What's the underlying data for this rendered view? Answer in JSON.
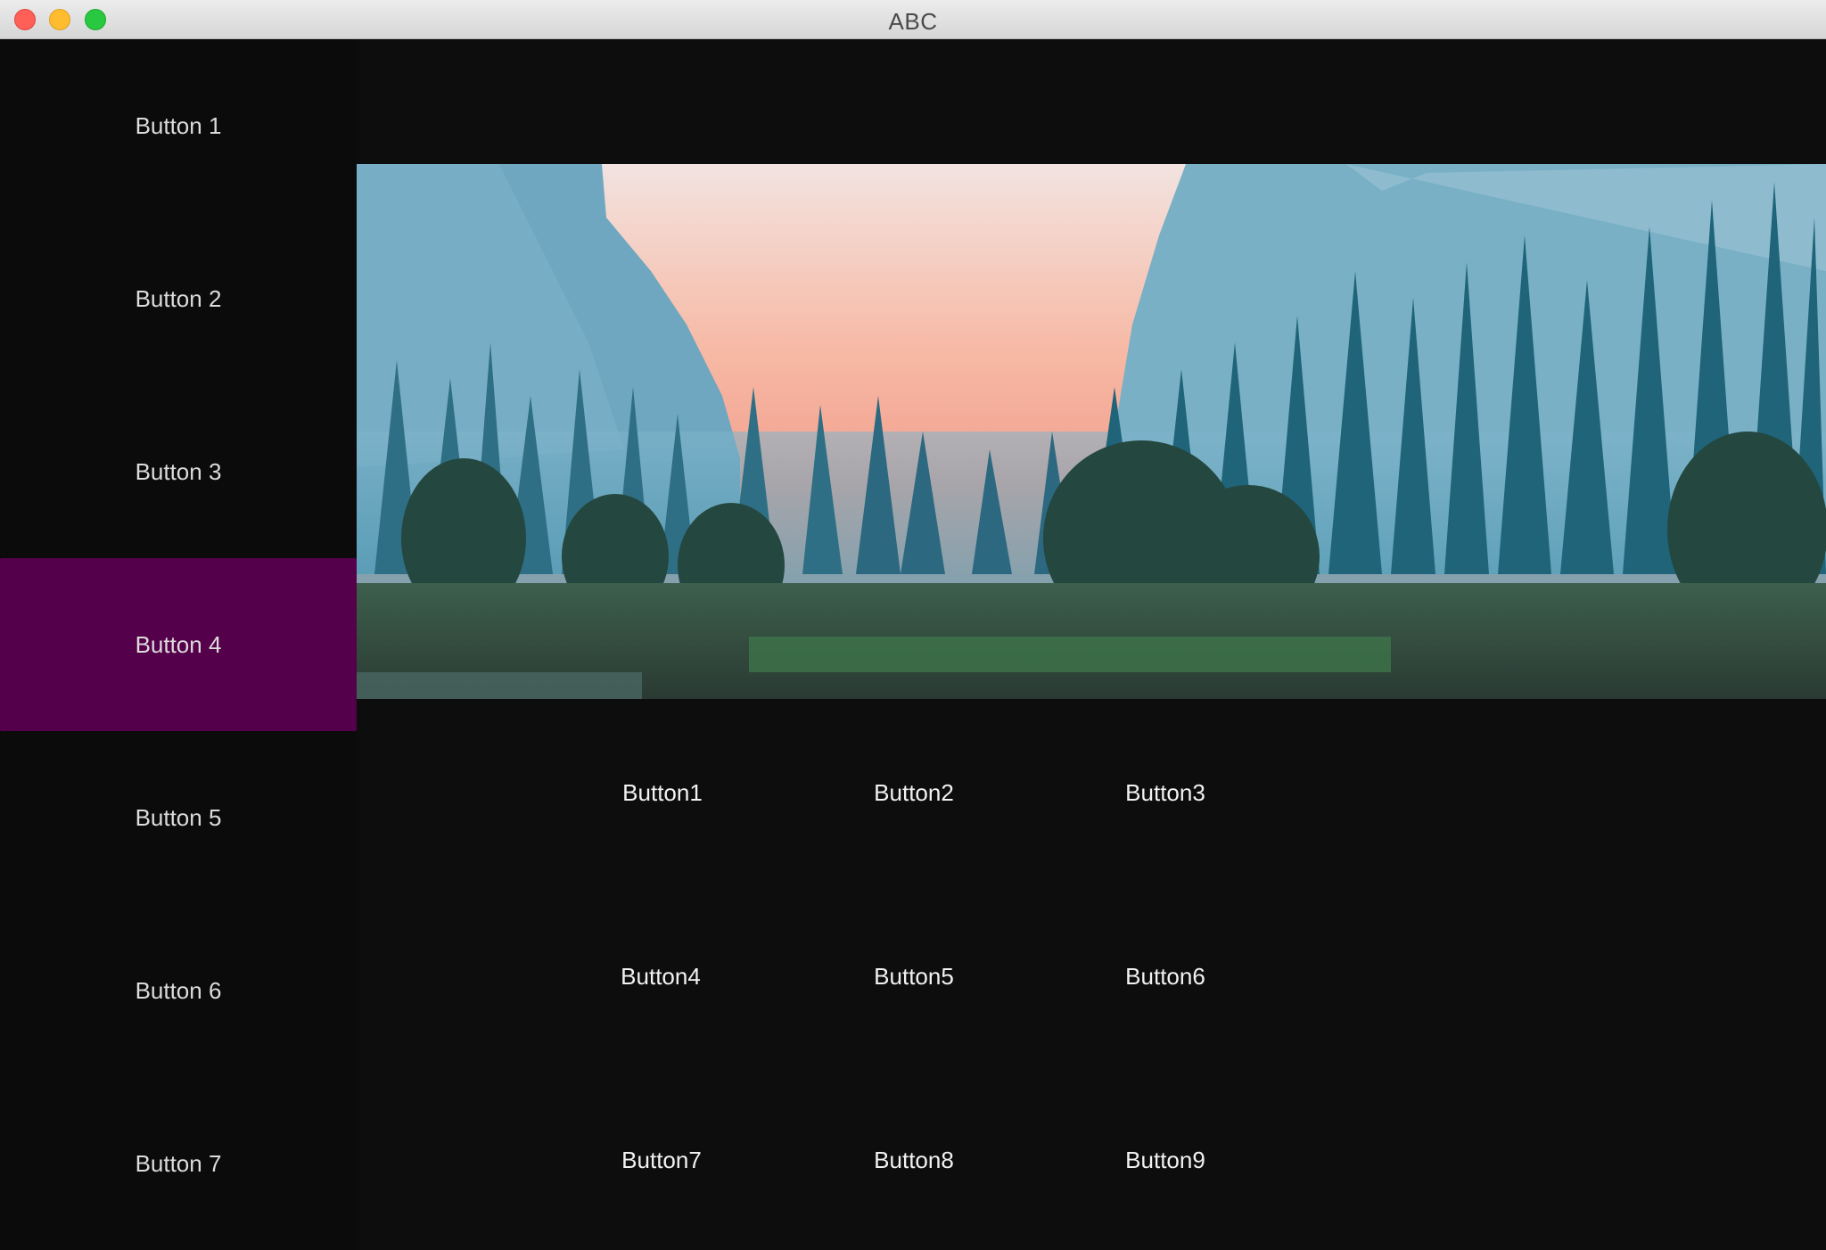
{
  "window": {
    "title": "ABC"
  },
  "sidebar": {
    "items": [
      {
        "label": "Button 1",
        "active": false
      },
      {
        "label": "Button 2",
        "active": false
      },
      {
        "label": "Button 3",
        "active": false
      },
      {
        "label": "Button 4",
        "active": true
      },
      {
        "label": "Button 5",
        "active": false
      },
      {
        "label": "Button 6",
        "active": false
      },
      {
        "label": "Button 7",
        "active": false
      }
    ]
  },
  "hero": {
    "description_icon": "landscape-image"
  },
  "grid": {
    "buttons": [
      {
        "label": "Button1"
      },
      {
        "label": "Button2"
      },
      {
        "label": "Button3"
      },
      {
        "label": "Button4"
      },
      {
        "label": "Button5"
      },
      {
        "label": "Button6"
      },
      {
        "label": "Button7"
      },
      {
        "label": "Button8"
      },
      {
        "label": "Button9"
      }
    ]
  },
  "colors": {
    "background": "#0d0d0e",
    "active_accent": "#55004a",
    "text": "#dcdcdc"
  }
}
